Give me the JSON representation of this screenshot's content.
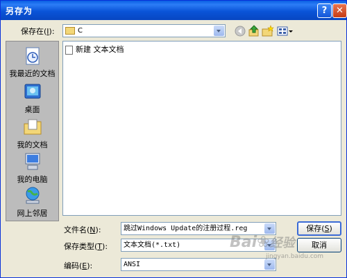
{
  "window": {
    "title": "另存为",
    "help": "?",
    "close": "✕"
  },
  "save_in": {
    "label": "保存在",
    "mnemonic": "I",
    "suffix": "):",
    "value": "C"
  },
  "places": [
    {
      "label": "我最近的文档",
      "icon": "recent-documents-icon"
    },
    {
      "label": "桌面",
      "icon": "desktop-icon"
    },
    {
      "label": "我的文档",
      "icon": "my-documents-icon"
    },
    {
      "label": "我的电脑",
      "icon": "my-computer-icon"
    },
    {
      "label": "网上邻居",
      "icon": "network-places-icon"
    }
  ],
  "files": [
    {
      "name": "新建 文本文档",
      "icon": "text-file-icon"
    }
  ],
  "filename": {
    "label": "文件名",
    "mnemonic": "N",
    "suffix": "):",
    "value": "跳过Windows Update的注册过程.reg"
  },
  "filetype": {
    "label": "保存类型",
    "mnemonic": "T",
    "suffix": "):",
    "value": "文本文档(*.txt)"
  },
  "encoding": {
    "label": "编码",
    "mnemonic": "E",
    "suffix": "):",
    "value": "ANSI"
  },
  "buttons": {
    "save": "保存",
    "save_key": "S",
    "cancel": "取消"
  },
  "watermark": {
    "brand": "Bai",
    "brand2": "经验",
    "url": "jingyan.baidu.com"
  }
}
